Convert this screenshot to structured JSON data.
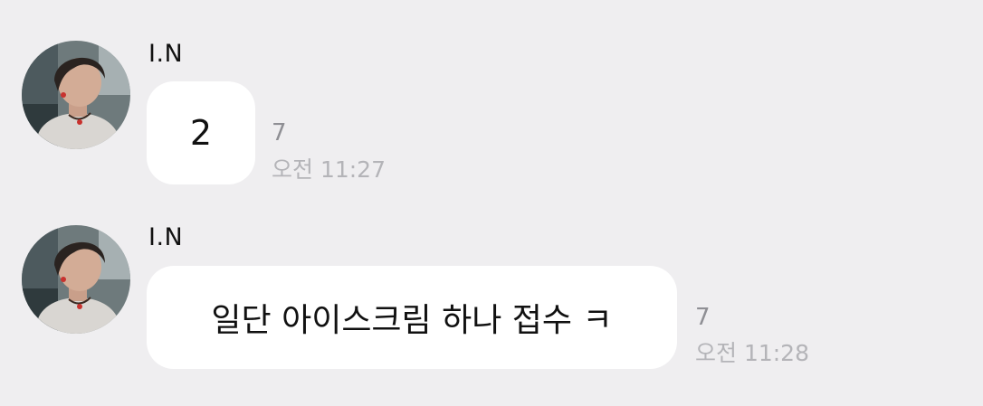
{
  "messages": [
    {
      "sender": "I.N",
      "text": "2",
      "unread": "7",
      "time": "오전 11:27"
    },
    {
      "sender": "I.N",
      "text": "일단 아이스크림 하나 접수 ㅋ",
      "unread": "7",
      "time": "오전 11:28"
    }
  ]
}
